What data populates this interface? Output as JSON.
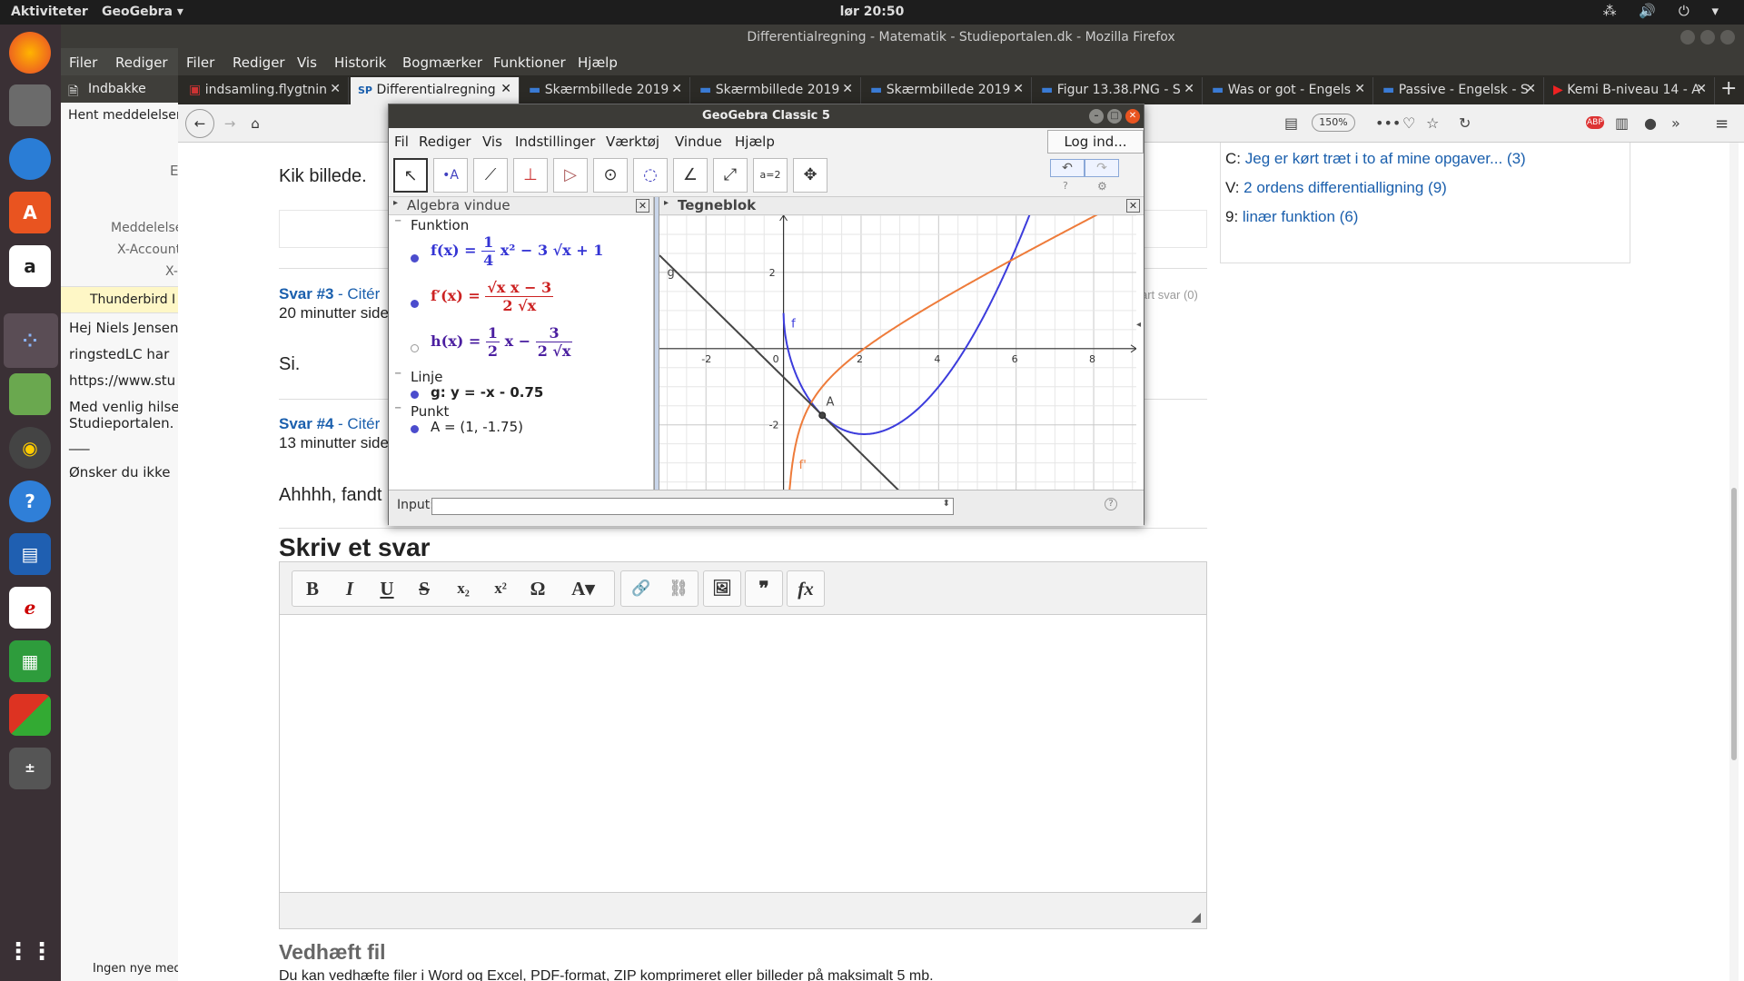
{
  "topbar": {
    "activities": "Aktiviteter",
    "app": "GeoGebra ▾",
    "clock": "lør 20:50",
    "tray": "⁂ 🔊 ⏻ ▾"
  },
  "thunderbird": {
    "menu": [
      "Filer",
      "Rediger"
    ],
    "tab": "Indbakke",
    "toolbar": "Hent meddelelser",
    "fields": [
      "E",
      "Meddelelse",
      "X-Account",
      "X-"
    ],
    "notice": "Thunderbird I",
    "body": [
      "Hej Niels Jensen",
      "ringstedLC har",
      "https://www.stu",
      "Med venlig hilse",
      "Studieportalen.",
      "___",
      "Ønsker du ikke"
    ],
    "status": "Ingen nye med"
  },
  "firefox": {
    "title": "Differentialregning - Matematik - Studieportalen.dk - Mozilla Firefox",
    "menu": [
      "Filer",
      "Rediger",
      "Vis",
      "Historik",
      "Bogmærker",
      "Funktioner",
      "Hjælp"
    ],
    "tabs": [
      {
        "label": "indsamling.flygtnin",
        "icon": "doc-icon"
      },
      {
        "label": "Differentialregning",
        "icon": "sp-icon",
        "prefix": "SP"
      },
      {
        "label": "Skærmbillede 2019",
        "icon": "image-icon"
      },
      {
        "label": "Skærmbillede 2019",
        "icon": "image-icon"
      },
      {
        "label": "Skærmbillede 2019",
        "icon": "image-icon"
      },
      {
        "label": "Figur 13.38.PNG - S",
        "icon": "image-icon"
      },
      {
        "label": "Was or got - Engels",
        "icon": "image-icon"
      },
      {
        "label": "Passive - Engelsk - S",
        "icon": "image-icon"
      },
      {
        "label": "Kemi B-niveau 14 - A",
        "icon": "youtube-icon"
      }
    ],
    "new_tab": "+",
    "zoom": "150%",
    "icons": {
      "more": "•••",
      "pocket": "♡",
      "star": "☆",
      "reload": "↻",
      "abp": "ABP",
      "library": "▥",
      "account": "●",
      "overflow": "»",
      "menu": "≡"
    }
  },
  "page": {
    "kik": "Kik billede.",
    "svar3_title": "Svar #3",
    "svar3_cite": " - Citér",
    "svar3_time": "20 minutter side",
    "start_svar": "art svar (0)",
    "si": "Si.",
    "svar4_title": "Svar #4",
    "svar4_cite": " - Citér",
    "svar4_time": "13 minutter side",
    "ahhh": "Ahhhh, fandt",
    "skriv": "Skriv et svar",
    "vedhaeft": "Vedhæft fil",
    "vedhaeft_desc": "Du kan vedhæfte filer i Word og Excel, PDF-format, ZIP komprimeret eller billeder på maksimalt 5 mb.",
    "sidebar": [
      {
        "prefix": "C: ",
        "link": "Jeg er kørt træt i to af mine opgaver... (3)"
      },
      {
        "prefix": "V: ",
        "link": "2 ordens differentialligning (9)"
      },
      {
        "prefix": "9: ",
        "link": "linær funktion (6)"
      }
    ],
    "editor_buttons": [
      "B",
      "I",
      "U",
      "S",
      "x₂",
      "x²",
      "Ω",
      "A▾",
      "🔗",
      "⛓",
      "🖼",
      "❞",
      "fx"
    ]
  },
  "geogebra": {
    "title": "GeoGebra Classic 5",
    "menu": [
      "Fil",
      "Rediger",
      "Vis",
      "Indstillinger",
      "Værktøj",
      "Vindue",
      "Hjælp"
    ],
    "login": "Log ind...",
    "tools": [
      "↖",
      "•A",
      "⟋",
      "⊥",
      "▷",
      "⊙",
      "◌",
      "∠",
      "⤢",
      "a=2",
      "✥"
    ],
    "undo": "↶",
    "redo": "↷",
    "algebra_header": "Algebra vindue",
    "graphics_header": "Tegneblok",
    "groups": {
      "funktion": "Funktion",
      "linje": "Linje",
      "punkt": "Punkt"
    },
    "f_label": "f(x) =",
    "f_frac": {
      "n": "1",
      "d": "4"
    },
    "f_rest": "x² − 3 √x + 1",
    "fp_label": "f′(x) =",
    "fp_frac": {
      "n": "√x x − 3",
      "d": "2 √x"
    },
    "h_label": "h(x) =",
    "h_frac1": {
      "n": "1",
      "d": "2"
    },
    "h_mid": "x −",
    "h_frac2": {
      "n": "3",
      "d": "2 √x"
    },
    "line_g": "g: y = -x - 0.75",
    "point_a": "A = (1, -1.75)",
    "input_label": "Input:",
    "graph_labels": {
      "g": "g",
      "f": "f",
      "fprime": "f'",
      "A": "A"
    },
    "colors": {
      "f": "#3c3cdc",
      "fprime": "#ee7b3a",
      "g": "#444444",
      "h": "#4b1fa0"
    }
  },
  "chart_data": {
    "type": "line",
    "xlim": [
      -3.2,
      9.1
    ],
    "ylim": [
      -3.7,
      3.5
    ],
    "x_ticks": [
      -2,
      0,
      2,
      4,
      6,
      8
    ],
    "y_ticks": [
      -2,
      2
    ],
    "grid": true,
    "series": [
      {
        "name": "f",
        "expr": "1/4 x^2 - 3 sqrt(x) + 1",
        "color": "#3c3cdc"
      },
      {
        "name": "f'",
        "expr": "(sqrt(x) x - 3) / (2 sqrt(x))",
        "color": "#ee7b3a"
      },
      {
        "name": "g",
        "expr": "-x - 0.75",
        "color": "#444444"
      }
    ],
    "points": [
      {
        "name": "A",
        "x": 1,
        "y": -1.75
      }
    ]
  }
}
